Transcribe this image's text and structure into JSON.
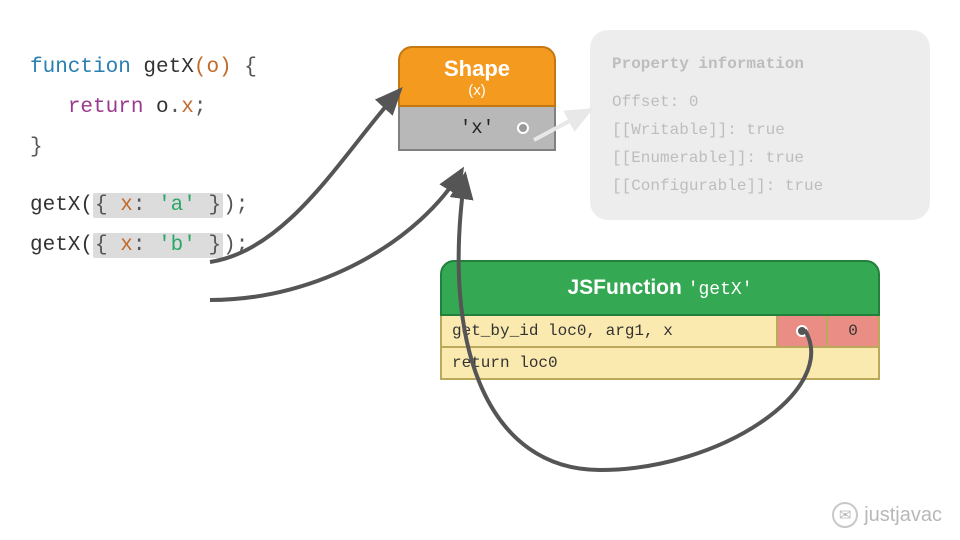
{
  "code": {
    "line1_kw": "function",
    "line1_fn": " getX",
    "line1_param": "(o) ",
    "line1_brace": "{",
    "line2_indent": "   ",
    "line2_ret": "return",
    "line2_expr": " o",
    "line2_dot": ".",
    "line2_prop": "x",
    "line2_semi": ";",
    "line3": "}",
    "call1_fn": "getX(",
    "call1_obj_open": "{ ",
    "call1_key": "x",
    "call1_colon": ": ",
    "call1_val": "'a'",
    "call1_obj_close": " }",
    "call1_end": ");",
    "call2_fn": "getX(",
    "call2_obj_open": "{ ",
    "call2_key": "x",
    "call2_colon": ": ",
    "call2_val": "'b'",
    "call2_obj_close": " }",
    "call2_end": ");"
  },
  "shape": {
    "title": "Shape",
    "subtitle": "(x)",
    "prop": "'x'"
  },
  "prop_info": {
    "title": "Property information",
    "offset": "Offset: 0",
    "writable": "[[Writable]]: true",
    "enumerable": "[[Enumerable]]: true",
    "configurable": "[[Configurable]]: true"
  },
  "jsfunction": {
    "label": "JSFunction",
    "name": "'getX'",
    "row1_instr": "get_by_id loc0, arg1, x",
    "row1_val": "0",
    "row2_instr": "return loc0"
  },
  "watermark": {
    "text": "justjavac"
  }
}
